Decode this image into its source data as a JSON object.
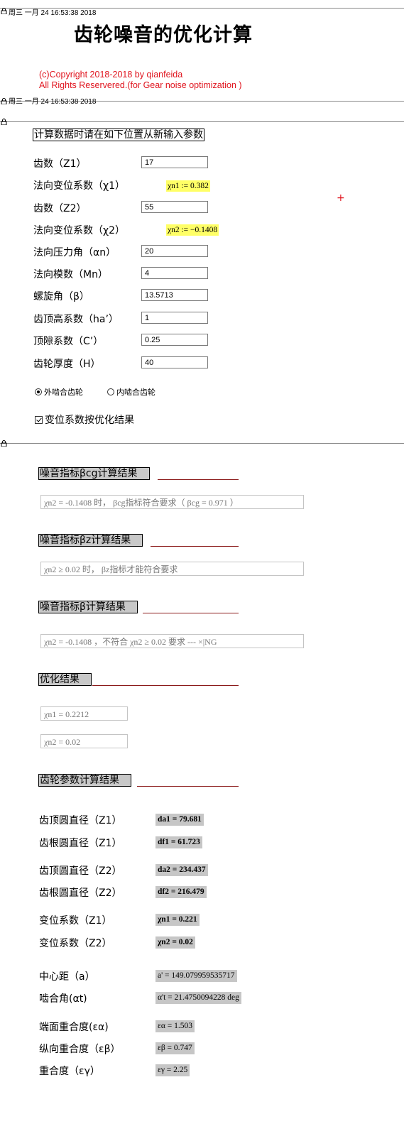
{
  "header": {
    "timestamp_top": "周三 一月 24 16:53:38 2018",
    "title": "齿轮噪音的优化计算",
    "copyright_line1": "(c)Copyright 2018-2018 by qianfeida",
    "copyright_line2": "All Rights Reservered.(for Gear noise optimization )",
    "timestamp_second": "周三 一月 24 16:53:38 2018"
  },
  "input_section": {
    "heading": "计算数据时请在如下位置从新输入参数",
    "z1_label": "齿数（Z1）",
    "z1_value": "17",
    "x1_label": "法向变位系数（χ1）",
    "x1_result": "χn1 := 0.382",
    "z2_label": "齿数（Z2）",
    "z2_value": "55",
    "x2_label": "法向变位系数（χ2）",
    "x2_result": "χn2 := −0.1408",
    "alpha_label": "法向压力角（αn）",
    "alpha_value": "20",
    "mn_label": "法向模数（Mn）",
    "mn_value": "4",
    "beta_label": "螺旋角（β）",
    "beta_value": "13.5713",
    "ha_label": "齿顶高系数（ha’）",
    "ha_value": "1",
    "c_label": "顶隙系数（C’）",
    "c_value": "0.25",
    "h_label": "齿轮厚度（H）",
    "h_value": "40",
    "radio_external": "外啮合齿轮",
    "radio_internal": "内啮合齿轮",
    "radio_selected": "external",
    "checkbox_label": "变位系数按优化结果",
    "checkbox_checked": true,
    "cursor_mark": "+"
  },
  "results": {
    "bcg_heading": "噪音指标βcg计算结果",
    "bcg_text": "χn2 = -0.1408 时， βcg指标符合要求（ βcg = 0.971 ）",
    "bz_heading": "噪音指标βz计算结果",
    "bz_text": "χn2 ≥ 0.02 时， βz指标才能符合要求",
    "b_heading": "噪音指标β计算结果",
    "b_text": "χn2 =  -0.1408 ，不符合 χn2 ≥ 0.02 要求 --- ×|NG",
    "opt_heading": "优化结果",
    "opt_xn1": "χn1 = 0.2212",
    "opt_xn2": "χn2 = 0.02",
    "gear_heading": "齿轮参数计算结果"
  },
  "gear_params": {
    "da1_label": "齿顶圆直径（Z1）",
    "da1_value": "da1 = 79.681",
    "df1_label": "齿根圆直径（Z1）",
    "df1_value": "df1 = 61.723",
    "da2_label": "齿顶圆直径（Z2）",
    "da2_value": "da2 = 234.437",
    "df2_label": "齿根圆直径（Z2）",
    "df2_value": "df2 = 216.479",
    "xn1_label": "变位系数（Z1）",
    "xn1_value": "χn1 = 0.221",
    "xn2_label": "变位系数（Z2）",
    "xn2_value": "χn2 = 0.02",
    "a_label": "中心距（a）",
    "a_value": "a' = 149.079959535717",
    "at_label": "啮合角(αt)",
    "at_value": "α't = 21.4750094228 deg",
    "ea_label": "端面重合度(εα)",
    "ea_value": "εα = 1.503",
    "eb_label": "纵向重合度（εβ）",
    "eb_value": "εβ = 0.747",
    "eg_label": "重合度（εγ）",
    "eg_value": "εγ = 2.25"
  },
  "colors": {
    "copyright": "#e0141e",
    "highlight": "#ffff66",
    "heading_bg": "#c8c8c8",
    "rule_red": "#8b1a1a"
  }
}
